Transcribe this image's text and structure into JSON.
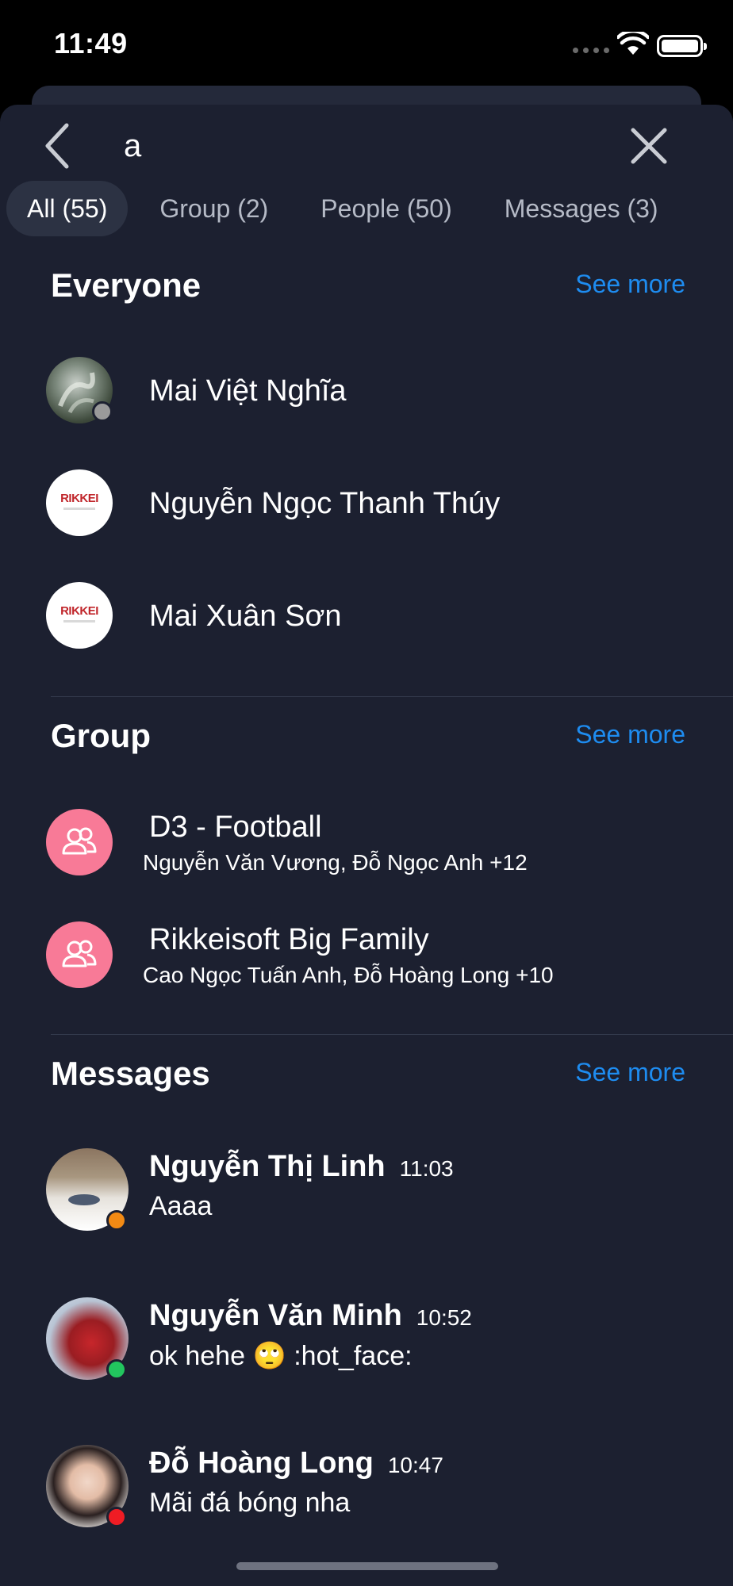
{
  "status_bar": {
    "time": "11:49"
  },
  "search": {
    "query": "a",
    "placeholder": ""
  },
  "tabs": [
    {
      "label": "All (55)",
      "active": true
    },
    {
      "label": "Group (2)",
      "active": false
    },
    {
      "label": "People (50)",
      "active": false
    },
    {
      "label": "Messages (3)",
      "active": false
    }
  ],
  "everyone": {
    "title": "Everyone",
    "see_more": "See more",
    "people": [
      {
        "name": "Mai Việt Nghĩa",
        "avatar": "photo-hands-avatar",
        "status": "offline"
      },
      {
        "name": "Nguyễn Ngọc Thanh Thúy",
        "avatar": "rikkei-logo-avatar"
      },
      {
        "name": "Mai Xuân Sơn",
        "avatar": "rikkei-logo-avatar"
      }
    ],
    "logo_text": "RIKKEI"
  },
  "group": {
    "title": "Group",
    "see_more": "See more",
    "items": [
      {
        "name": "D3 - Football",
        "members": "Nguyễn Văn Vương, Đỗ Ngọc Anh +12",
        "avatar": "group-icon"
      },
      {
        "name": "Rikkeisoft Big Family",
        "members": "Cao Ngọc Tuấn Anh, Đỗ Hoàng Long +10",
        "avatar": "group-icon"
      }
    ]
  },
  "messages": {
    "title": "Messages",
    "see_more": "See more",
    "items": [
      {
        "name": "Nguyễn Thị Linh",
        "time": "11:03",
        "text": "Aaaa",
        "status": "away"
      },
      {
        "name": "Nguyễn Văn Minh",
        "time": "10:52",
        "text": "ok hehe 🙄 :hot_face:",
        "status": "online"
      },
      {
        "name": "Đỗ Hoàng Long",
        "time": "10:47",
        "text": "Mãi đá bóng nha",
        "status": "busy"
      }
    ]
  },
  "colors": {
    "background": "#1c2030",
    "accent": "#1e8cf0",
    "group_avatar": "#f87a97",
    "status_offline": "#9a9a9a",
    "status_away": "#f28a14",
    "status_online": "#22c55e",
    "status_busy": "#ef1c24"
  }
}
